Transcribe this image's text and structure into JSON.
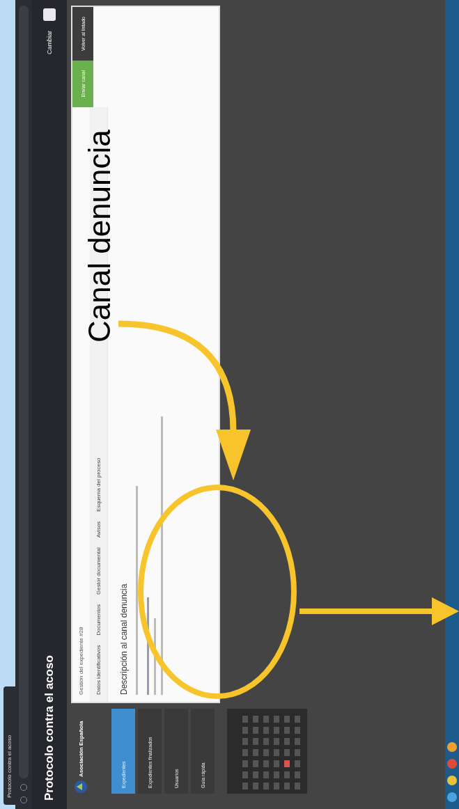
{
  "browser": {
    "tab_title": "Protocolo contra el acoso"
  },
  "header": {
    "title": "Protocolo contra el acoso",
    "link": "Cambiar"
  },
  "sidebar": {
    "brand": "Asociación Española",
    "items": [
      {
        "label": "Expedientes",
        "selected": true
      },
      {
        "label": "Expedientes finalizados",
        "selected": false
      },
      {
        "label": "Usuarios",
        "selected": false
      },
      {
        "label": "Guía rápida",
        "selected": false
      }
    ]
  },
  "card": {
    "breadcrumb": "Gestión del expediente #28",
    "tabs": [
      {
        "label": "Datos identificativos",
        "selected": false
      },
      {
        "label": "Documentos",
        "selected": false
      },
      {
        "label": "Gestor documental",
        "selected": false
      },
      {
        "label": "Avisos",
        "selected": false
      },
      {
        "label": "Esquema del proceso",
        "selected": false
      }
    ],
    "buttons": [
      {
        "label": "Enviar canal",
        "kind": "primary"
      },
      {
        "label": "Volver al listado",
        "kind": "secondary"
      }
    ],
    "heading": "Descripción al canal denuncia"
  },
  "annotation": {
    "label": "Canal denuncia"
  }
}
